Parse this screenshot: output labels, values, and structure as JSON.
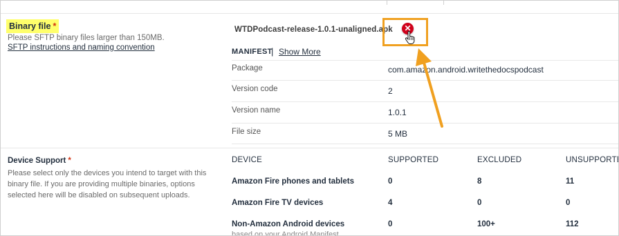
{
  "binary_file": {
    "label": "Binary file",
    "required_mark": "*",
    "description": "Please SFTP binary files larger than 150MB.",
    "link": "SFTP instructions and naming convention",
    "filename": "WTDPodcast-release-1.0.1-unaligned.apk",
    "remove_icon": "close-icon",
    "highlight_color": "#ffff6b",
    "callout_color": "#f0a020"
  },
  "manifest": {
    "title": "MANIFEST",
    "separator": "|",
    "show_more": "Show More",
    "rows": [
      {
        "key": "Package",
        "value": "com.amazon.android.writethedocspodcast"
      },
      {
        "key": "Version code",
        "value": "2"
      },
      {
        "key": "Version name",
        "value": "1.0.1"
      },
      {
        "key": "File size",
        "value": "5 MB"
      }
    ]
  },
  "device_support": {
    "label": "Device Support",
    "required_mark": "*",
    "description": "Please select only the devices you intend to target with this binary file. If you are providing multiple binaries, options selected here will be disabled on subsequent uploads.",
    "columns": [
      "DEVICE",
      "SUPPORTED",
      "EXCLUDED",
      "UNSUPPORTED"
    ],
    "rows": [
      {
        "device": "Amazon Fire phones and tablets",
        "supported": "0",
        "excluded": "8",
        "unsupported": "11"
      },
      {
        "device": "Amazon Fire TV devices",
        "supported": "4",
        "excluded": "0",
        "unsupported": "0"
      },
      {
        "device": "Non-Amazon Android devices",
        "supported": "0",
        "excluded": "100+",
        "unsupported": "112"
      }
    ],
    "footnote": "based on your Android Manifest"
  }
}
